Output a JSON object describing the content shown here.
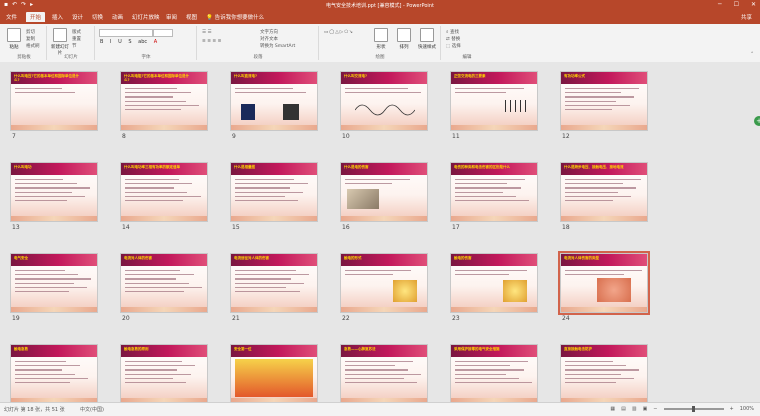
{
  "window": {
    "title": "电气安全技术培训.ppt [兼容模式] - PowerPoint",
    "quick_access": [
      "save-icon",
      "undo-icon",
      "redo-icon",
      "present-icon"
    ]
  },
  "tabs": [
    {
      "label": "文件"
    },
    {
      "label": "开始"
    },
    {
      "label": "插入"
    },
    {
      "label": "设计"
    },
    {
      "label": "切换"
    },
    {
      "label": "动画"
    },
    {
      "label": "幻灯片放映"
    },
    {
      "label": "审阅"
    },
    {
      "label": "视图"
    }
  ],
  "tell_me": "告诉我你想要做什么",
  "share": "共享",
  "ribbon": {
    "clipboard": {
      "paste": "粘贴",
      "cut": "剪切",
      "copy": "复制",
      "format_painter": "格式刷",
      "group": "剪贴板"
    },
    "slides": {
      "new_slide": "新建幻灯片",
      "layout": "版式",
      "reset": "重置",
      "section": "节",
      "group": "幻灯片"
    },
    "font": {
      "name": "",
      "size": "",
      "group": "字体",
      "bold": "B",
      "italic": "I",
      "underline": "U",
      "strike": "S",
      "shadow": "abc",
      "color": "A"
    },
    "paragraph": {
      "group": "段落",
      "text_direction": "文字方向",
      "align_text": "对齐文本",
      "smartart": "转换为 SmartArt"
    },
    "drawing": {
      "shapes": "形状",
      "arrange": "排列",
      "quick_styles": "快速样式",
      "group": "绘图"
    },
    "editing": {
      "find": "查找",
      "replace": "替换",
      "select": "选择",
      "group": "编辑"
    }
  },
  "slides": [
    {
      "n": "7",
      "title": "什么叫电压?它的基本单位和国际单位是什么?",
      "kind": "image-box"
    },
    {
      "n": "8",
      "title": "什么叫电阻?它的基本单位和国际单位是什么?",
      "kind": "text"
    },
    {
      "n": "9",
      "title": "什么叫直流电?",
      "kind": "two-images"
    },
    {
      "n": "10",
      "title": "什么叫交流电?",
      "kind": "wave"
    },
    {
      "n": "11",
      "title": "正弦交流电的三要素",
      "kind": "circuit"
    },
    {
      "n": "12",
      "title": "有功功率公式",
      "kind": "text"
    },
    {
      "n": "13",
      "title": "什么叫电功",
      "kind": "text"
    },
    {
      "n": "14",
      "title": "什么叫电功率三相有功率的额定值单",
      "kind": "text"
    },
    {
      "n": "15",
      "title": "什么是相量图",
      "kind": "text"
    },
    {
      "n": "16",
      "title": "什么是电的伤害",
      "kind": "photo"
    },
    {
      "n": "17",
      "title": "电伤的种类和电击伤害的区别是什么",
      "kind": "text"
    },
    {
      "n": "18",
      "title": "什么是跨步电压、接触电压、接地电流",
      "kind": "text"
    },
    {
      "n": "19",
      "title": "电气安全",
      "kind": "text"
    },
    {
      "n": "20",
      "title": "电流对人体的伤害",
      "kind": "text"
    },
    {
      "n": "21",
      "title": "电流途径对人体的伤害",
      "kind": "text"
    },
    {
      "n": "22",
      "title": "触电的形式",
      "kind": "illustration"
    },
    {
      "n": "23",
      "title": "触电的伤害",
      "kind": "illustration"
    },
    {
      "n": "24",
      "title": "电流对人体伤害的类型",
      "kind": "hand-photo"
    },
    {
      "n": "",
      "title": "触电急救",
      "kind": "text"
    },
    {
      "n": "",
      "title": "触电急救的原则",
      "kind": "text"
    },
    {
      "n": "",
      "title": "安全第一位",
      "kind": "poster"
    },
    {
      "n": "",
      "title": "急救——心肺复苏法",
      "kind": "text"
    },
    {
      "n": "",
      "title": "采用保护接零的电气安全措施",
      "kind": "text"
    },
    {
      "n": "",
      "title": "直接接触电击防护",
      "kind": "text"
    }
  ],
  "side_button": "+",
  "status": {
    "slide_info": "幻灯片 第 18 张，共 51 张",
    "language": "中文(中国)",
    "zoom": "100%",
    "zoom_level": 0.5
  },
  "colors": {
    "accent": "#b7472a",
    "slide_header": "#c2185b",
    "slide_title": "#ffd400",
    "selection": "#d2634b"
  }
}
